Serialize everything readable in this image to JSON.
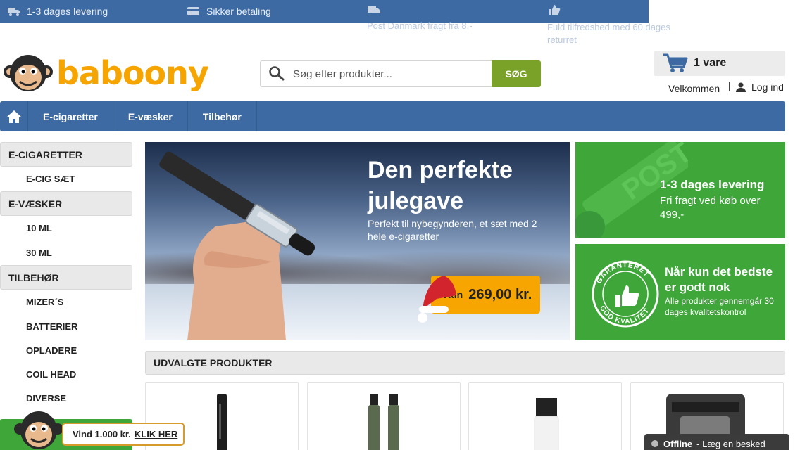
{
  "topbar": {
    "delivery": "1-3 dages levering",
    "payment": "Sikker betaling",
    "shipping": "Post Danmark fragt fra 8,-",
    "satisfaction": "Fuld tilfredshed med 60 dages returret"
  },
  "header": {
    "logo_text": "baboony",
    "search_placeholder": "Søg efter produkter...",
    "search_button": "SØG",
    "cart_label": "1 vare",
    "welcome": "Velkommen",
    "login": "Log ind"
  },
  "nav": {
    "items": [
      "E-cigaretter",
      "E-væsker",
      "Tilbehør"
    ]
  },
  "sidebar": {
    "categories": [
      {
        "label": "E-CIGARETTER",
        "sub": [
          "E-CIG SÆT"
        ]
      },
      {
        "label": "E-VÆSKER",
        "sub": [
          "10 ML",
          "30 ML"
        ]
      },
      {
        "label": "TILBEHØR",
        "sub": [
          "MIZER´S",
          "BATTERIER",
          "OPLADERE",
          "COIL HEAD",
          "DIVERSE"
        ]
      }
    ]
  },
  "hero": {
    "title": "Den perfekte julegave",
    "subtitle": "Perfekt til nybegynderen, et sæt med 2 hele e-cigaretter",
    "price_prefix": "Kun",
    "price": "269,00 kr."
  },
  "promos": {
    "delivery_title": "1-3 dages levering",
    "delivery_text": "Fri fragt ved køb over 499,-",
    "quality_title": "Når kun det bedste er godt nok",
    "quality_text": "Alle produkter gennemgår 30 dages kvalitetskontrol",
    "stamp_top": "GARANTERET",
    "stamp_bottom": "GOD KVALITET",
    "post_stamp": "POST"
  },
  "featured": {
    "title": "UDVALGTE PRODUKTER"
  },
  "bottom": {
    "win_text": "Vind 1.000 kr.",
    "win_link": "KLIK HER",
    "chat_status": "Offline",
    "chat_text": "- Læg en besked"
  },
  "colors": {
    "brand_blue": "#3d6aa3",
    "brand_green": "#3fa63a",
    "logo_orange": "#f5a400",
    "search_green": "#7ba228"
  }
}
